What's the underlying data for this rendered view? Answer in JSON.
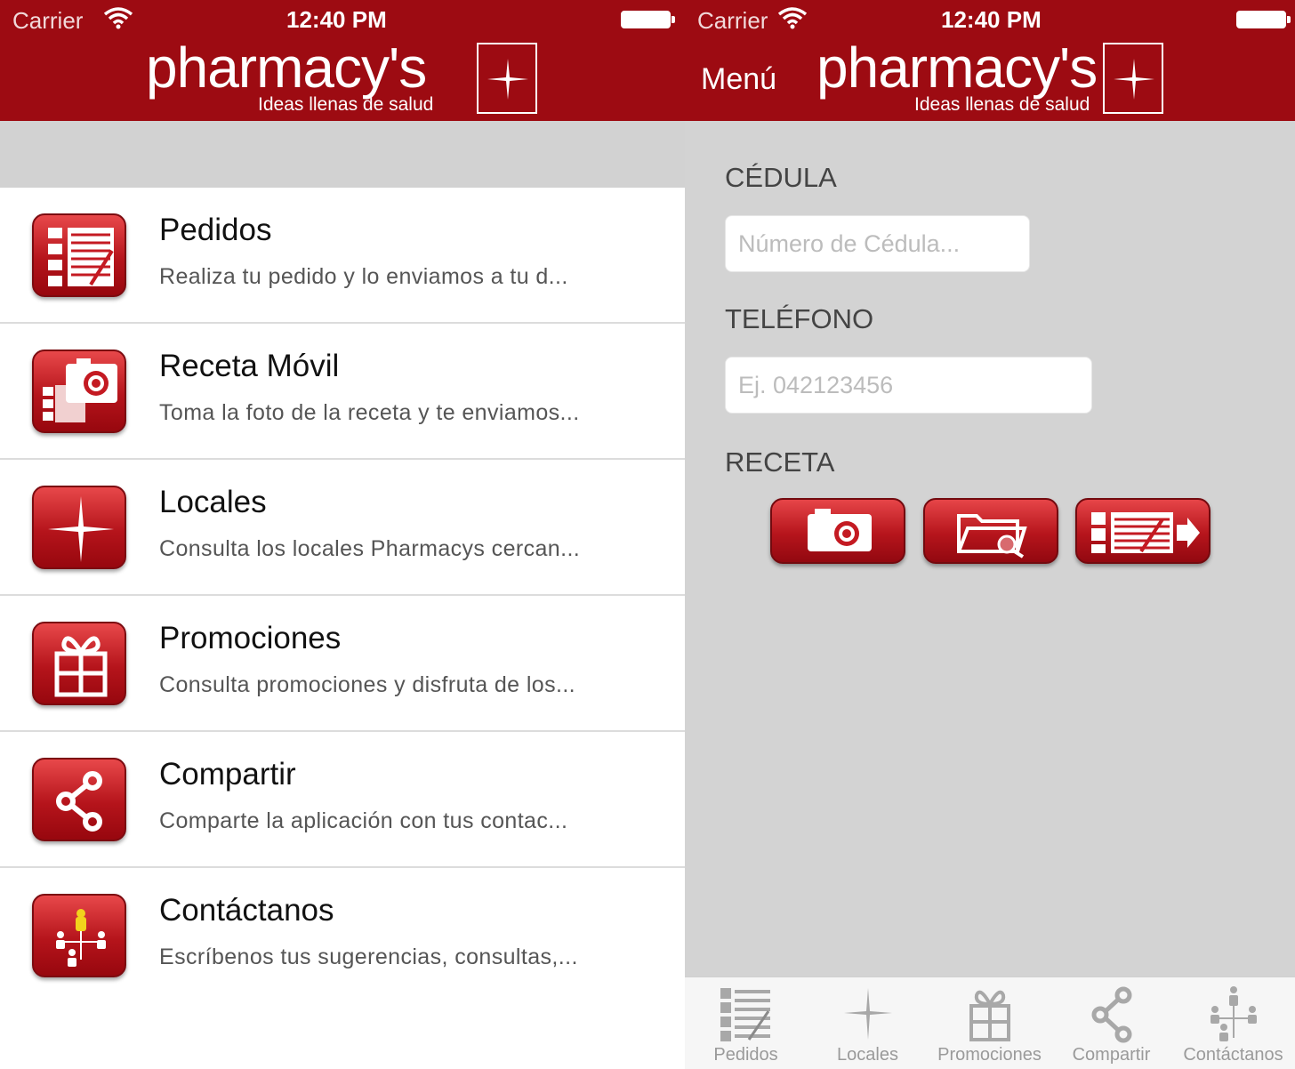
{
  "status_bar": {
    "carrier": "Carrier",
    "time": "12:40 PM"
  },
  "brand": {
    "name": "pharmacy's",
    "tagline": "Ideas llenas de salud"
  },
  "colors": {
    "brand_red": "#9d0b12",
    "accent_red": "#c41a22",
    "background_gray": "#d3d3d3"
  },
  "menu": {
    "items": [
      {
        "title": "Pedidos",
        "description": "Realiza tu pedido y lo enviamos a tu d...",
        "icon": "order-list-icon"
      },
      {
        "title": "Receta Móvil",
        "description": "Toma la foto de la receta y te enviamos...",
        "icon": "camera-prescription-icon"
      },
      {
        "title": "Locales",
        "description": "Consulta los locales Pharmacys cercan...",
        "icon": "sparkle-icon"
      },
      {
        "title": "Promociones",
        "description": "Consulta promociones y disfruta de los...",
        "icon": "gift-icon"
      },
      {
        "title": "Compartir",
        "description": "Comparte la aplicación con tus contac...",
        "icon": "share-icon"
      },
      {
        "title": "Contáctanos",
        "description": "Escríbenos tus sugerencias, consultas,...",
        "icon": "contacts-icon"
      }
    ]
  },
  "receta_form": {
    "menu_button": "Menú",
    "cedula_label": "CÉDULA",
    "cedula_placeholder": "Número de Cédula...",
    "telefono_label": "TELÉFONO",
    "telefono_placeholder": "Ej. 042123456",
    "receta_label": "RECETA",
    "actions": [
      "camera-icon",
      "folder-search-icon",
      "send-list-icon"
    ]
  },
  "tab_bar": {
    "tabs": [
      {
        "label": "Pedidos",
        "icon": "order-list-icon"
      },
      {
        "label": "Locales",
        "icon": "sparkle-icon"
      },
      {
        "label": "Promociones",
        "icon": "gift-icon"
      },
      {
        "label": "Compartir",
        "icon": "share-icon"
      },
      {
        "label": "Contáctanos",
        "icon": "contacts-icon"
      }
    ]
  }
}
